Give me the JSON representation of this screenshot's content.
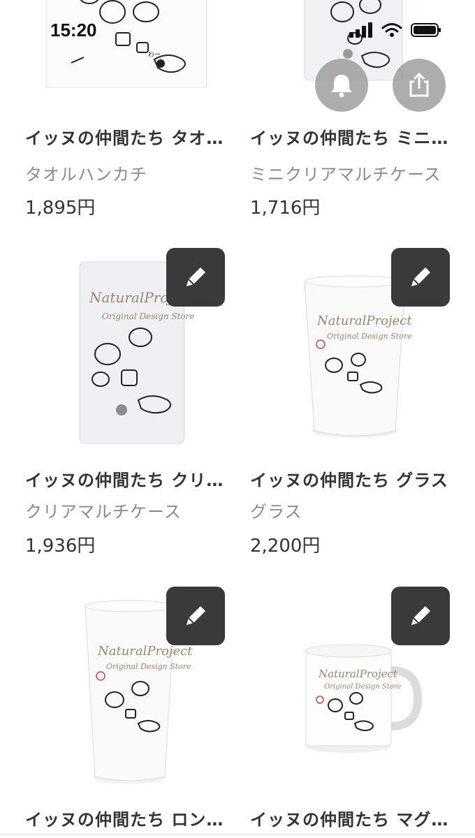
{
  "status_bar": {
    "time": "15:20"
  },
  "products": [
    {
      "title": "イッヌの仲間たち タオルハンカチ",
      "type": "タオルハンカチ",
      "price": "1,895円",
      "item": "towel"
    },
    {
      "title": "イッヌの仲間たち ミニクリアマルチケース",
      "type": "ミニクリアマルチケース",
      "price": "1,716円",
      "item": "mini-case"
    },
    {
      "title": "イッヌの仲間たち クリアマルチケース",
      "type": "クリアマルチケース",
      "price": "1,936円",
      "item": "clear-case"
    },
    {
      "title": "イッヌの仲間たち グラス",
      "type": "グラス",
      "price": "2,200円",
      "item": "glass"
    },
    {
      "title": "イッヌの仲間たち ロンググラス",
      "type": "",
      "price": "",
      "item": "long-glass"
    },
    {
      "title": "イッヌの仲間たち マグカップ",
      "type": "",
      "price": "",
      "item": "mug"
    }
  ],
  "design_text": {
    "line1": "NaturalProject",
    "line2": "Original Design Store",
    "bark": "わー"
  },
  "colors": {
    "edit_button_bg": "#3a3a3a",
    "floating_button_bg": "#969696",
    "brand_text": "#9c8468"
  }
}
